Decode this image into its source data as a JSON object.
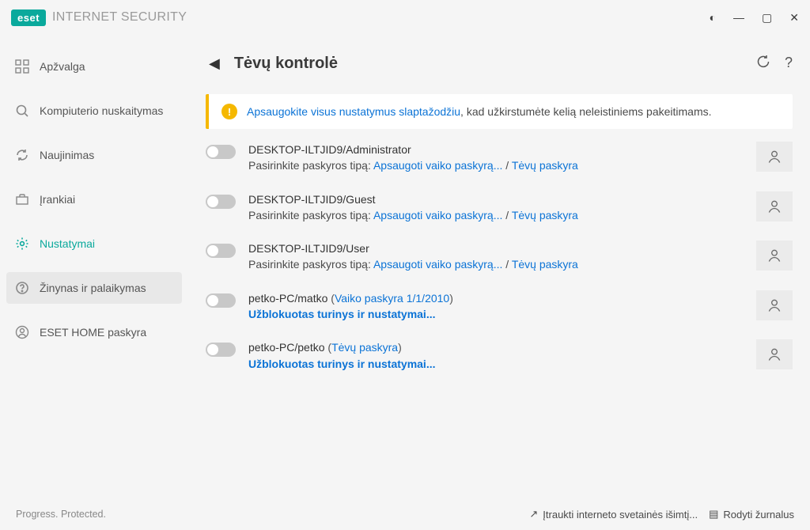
{
  "product": {
    "brand": "eset",
    "name": "INTERNET SECURITY"
  },
  "sidebar": {
    "items": [
      {
        "label": "Apžvalga"
      },
      {
        "label": "Kompiuterio nuskaitymas"
      },
      {
        "label": "Naujinimas"
      },
      {
        "label": "Įrankiai"
      },
      {
        "label": "Nustatymai"
      },
      {
        "label": "Žinynas ir palaikymas"
      },
      {
        "label": "ESET HOME paskyra"
      }
    ]
  },
  "page": {
    "title": "Tėvų kontrolė"
  },
  "notice": {
    "link_text": "Apsaugokite visus nustatymus slaptažodžiu",
    "tail": ", kad užkirstumėte kelią neleistiniems pakeitimams."
  },
  "common": {
    "type_label": "Pasirinkite paskyros tipą: ",
    "protect_link": "Apsaugoti vaiko paskyrą...",
    "separator": " / ",
    "parent_link": "Tėvų paskyra",
    "blocked_link": "Užblokuotas turinys ir nustatymai..."
  },
  "accounts": [
    {
      "name": "DESKTOP-ILTJID9/Administrator"
    },
    {
      "name": "DESKTOP-ILTJID9/Guest"
    },
    {
      "name": "DESKTOP-ILTJID9/User"
    }
  ],
  "special_accounts": [
    {
      "name": "petko-PC/matko",
      "role_prefix": " (",
      "role": "Vaiko paskyra 1/1/2010",
      "role_suffix": ")"
    },
    {
      "name": "petko-PC/petko",
      "role_prefix": " (",
      "role": "Tėvų paskyra",
      "role_suffix": ")"
    }
  ],
  "footer": {
    "slogan": "Progress. Protected.",
    "link1": "Įtraukti interneto svetainės išimtį...",
    "link2": "Rodyti žurnalus"
  }
}
